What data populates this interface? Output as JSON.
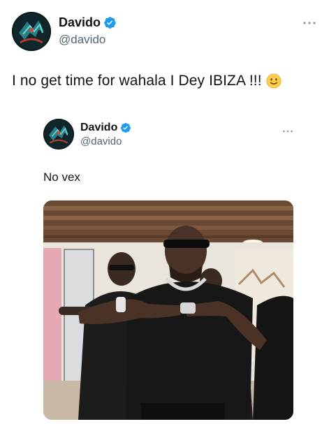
{
  "tweet": {
    "author_name": "Davido",
    "author_handle": "@davido",
    "text": "I no get time for wahala I Dey IBIZA !!!",
    "emoji": "slightly-smiling-face-icon"
  },
  "quoted_tweet": {
    "author_name": "Davido",
    "author_handle": "@davido",
    "text": "No vex",
    "media": "photo-man-in-sunglasses-dancing"
  },
  "colors": {
    "text_primary": "#0f1419",
    "text_secondary": "#536471",
    "verified_blue": "#1d9bf0"
  },
  "icons": [
    "verified-badge-icon",
    "more-options-icon",
    "slightly-smiling-face-icon"
  ]
}
